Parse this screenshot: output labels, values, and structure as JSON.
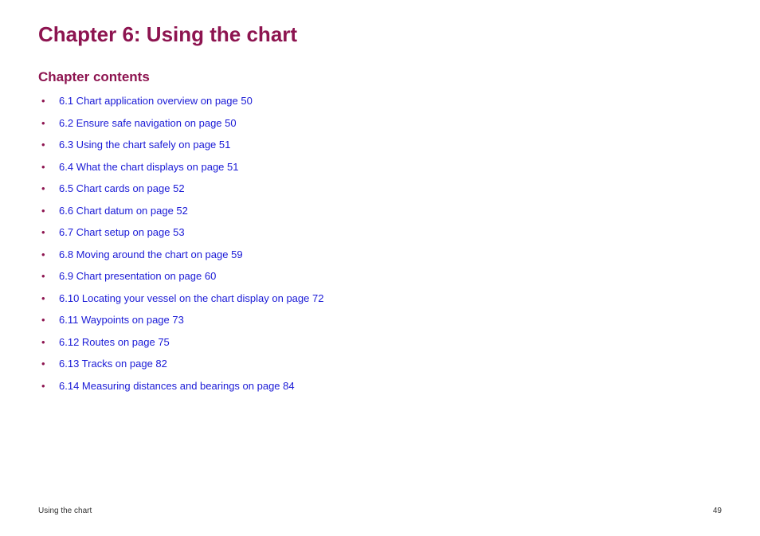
{
  "chapter_title": "Chapter 6: Using the chart",
  "section_title": "Chapter contents",
  "toc_items": [
    "6.1 Chart application overview on page 50",
    "6.2 Ensure safe navigation on page 50",
    "6.3 Using the chart safely on page 51",
    "6.4 What the chart displays on page 51",
    "6.5 Chart cards on page 52",
    "6.6 Chart datum on page 52",
    "6.7 Chart setup on page 53",
    "6.8 Moving around the chart on page 59",
    "6.9 Chart presentation on page 60",
    "6.10 Locating your vessel on the chart display on page 72",
    "6.11 Waypoints on page 73",
    "6.12 Routes on page 75",
    "6.13 Tracks on page 82",
    "6.14 Measuring distances and bearings on page 84"
  ],
  "footer": {
    "title": "Using the chart",
    "page_number": "49"
  }
}
